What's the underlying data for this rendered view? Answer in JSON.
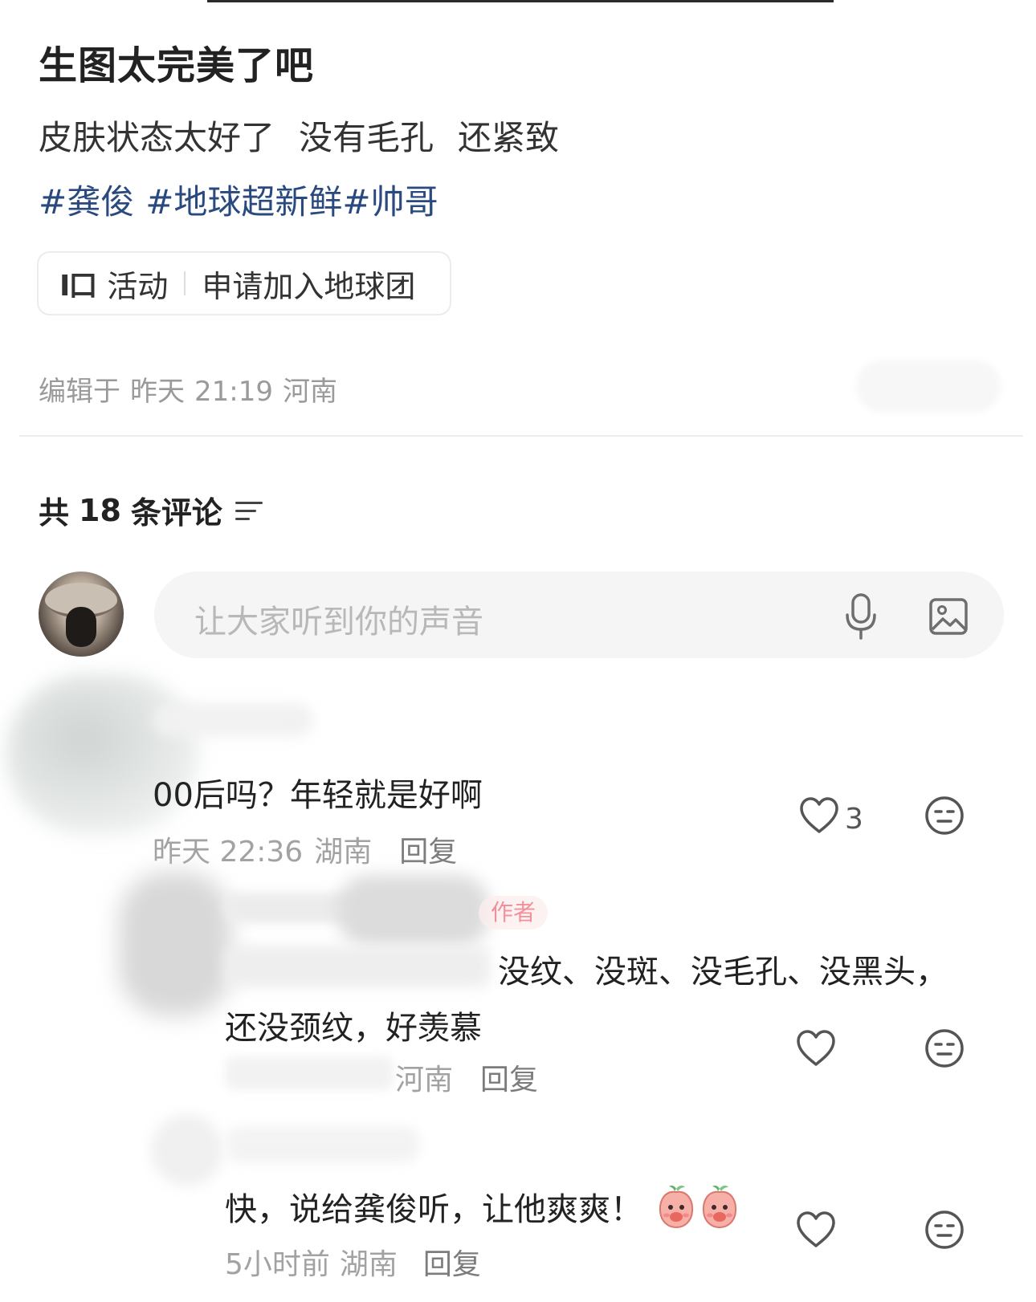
{
  "post": {
    "title": "生图太完美了吧",
    "body": [
      "皮肤状态太好了",
      "没有毛孔",
      "还紧致"
    ],
    "tags": [
      "#龚俊",
      "#地球超新鲜",
      "#帅哥"
    ],
    "activity": {
      "icon_text": "I口",
      "label": "活动",
      "text": "申请加入地球团"
    },
    "meta": {
      "edited": "编辑于",
      "day": "昨天",
      "time": "21:19",
      "location": "河南"
    }
  },
  "comments_header": {
    "prefix": "共",
    "count": "18",
    "suffix": "条评论"
  },
  "comment_input": {
    "placeholder": "让大家听到你的声音"
  },
  "comments": [
    {
      "text": "00后吗？年轻就是好啊",
      "date": "昨天 22:36",
      "location": "湖南",
      "reply": "回复",
      "likes": "3"
    },
    {
      "author_badge": "作者",
      "text_line1": "没纹、没斑、没毛孔、没黑头，",
      "text_line2": "还没颈纹，好羡慕",
      "location": "河南",
      "reply": "回复"
    },
    {
      "text": "快，说给龚俊听，让他爽爽！",
      "date": "5小时前",
      "location": "湖南",
      "reply": "回复"
    }
  ],
  "colors": {
    "tag_blue": "#2a4a7f",
    "meta_gray": "#9a9a9a",
    "author_pink": "#ee6b7a"
  },
  "icons": [
    "sort-icon",
    "mic-icon",
    "image-icon",
    "heart-icon",
    "emoji-face-icon",
    "peach-emoji-icon"
  ]
}
